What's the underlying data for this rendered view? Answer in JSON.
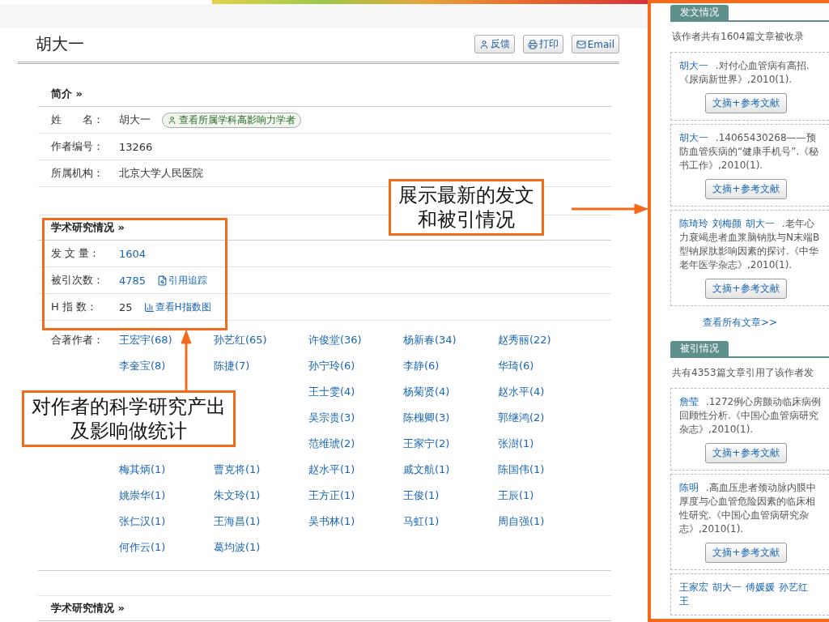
{
  "author_name": "胡大一",
  "actions": [
    {
      "label": "反馈",
      "kind": "feedback"
    },
    {
      "label": "打印",
      "kind": "print"
    },
    {
      "label": "Email",
      "kind": "email"
    }
  ],
  "profile": {
    "title": "简介 »",
    "rows": [
      {
        "label": "姓　　名：",
        "value": "胡大一",
        "badge": "查看所属学科高影响力学者"
      },
      {
        "label": "作者编号：",
        "value": "13266"
      },
      {
        "label": "所属机构：",
        "value": "北京大学人民医院"
      }
    ]
  },
  "research": {
    "title": "学术研究情况 »",
    "rows": [
      {
        "label": "发 文 量：",
        "value": "1604",
        "linked": true
      },
      {
        "label": "被引次数：",
        "value": "4785",
        "linked": true,
        "action": {
          "label": "引用追踪",
          "kind": "trace"
        }
      },
      {
        "label": "H 指 数：",
        "value": "25",
        "linked": false,
        "action": {
          "label": "查看H指数图",
          "kind": "chart"
        }
      }
    ],
    "coauthors_label": "合著作者：",
    "coauthors": [
      {
        "kind": "full",
        "names": [
          "王宏宇(68)",
          "孙艺红(65)",
          "许俊堂(36)",
          "杨新春(34)",
          "赵秀丽(22)"
        ]
      },
      {
        "kind": "full",
        "names": [
          "李奎宝(8)",
          "陈捷(7)",
          "孙宁玲(6)",
          "李静(6)",
          "华琦(6)"
        ]
      },
      {
        "kind": "covered",
        "names": [
          "王士雯(4)",
          "杨菊贤(4)",
          "赵水平(4)"
        ]
      },
      {
        "kind": "covered",
        "names": [
          "吴宗贵(3)",
          "陈槐卿(3)",
          "郭继鸿(2)"
        ]
      },
      {
        "kind": "covered",
        "names": [
          "范维琥(2)",
          "王家宁(2)",
          "张澍(1)"
        ]
      },
      {
        "kind": "full",
        "names": [
          "梅其炳(1)",
          "曹克将(1)",
          "赵水平(1)",
          "戚文航(1)",
          "陈国伟(1)"
        ]
      },
      {
        "kind": "full",
        "names": [
          "姚崇华(1)",
          "朱文玲(1)",
          "王方正(1)",
          "王俊(1)",
          "王辰(1)"
        ]
      },
      {
        "kind": "full",
        "names": [
          "张仁汉(1)",
          "王海昌(1)",
          "吴书林(1)",
          "马虹(1)",
          "周自强(1)"
        ]
      },
      {
        "kind": "full",
        "names": [
          "何作云(1)",
          "葛均波(1)"
        ]
      }
    ]
  },
  "section2": {
    "title": "学术研究情况 »"
  },
  "sidebar": {
    "sections": [
      {
        "tab": "发文情况",
        "summary": "该作者共有1604篇文章被收录",
        "items": [
          {
            "authors": [
              "胡大一"
            ],
            "text": " .对付心血管病有高招.《尿病新世界》,2010(1).",
            "button": "文摘+参考文献"
          },
          {
            "authors": [
              "胡大一"
            ],
            "text": " .14065430268——预防血管疾病的“健康手机号”.《秘书工作》,2010(1).",
            "button": "文摘+参考文献"
          },
          {
            "authors": [
              "陈琦玲",
              "刘梅颜",
              "胡大一"
            ],
            "text": " .老年心力衰竭患者血浆脑钠肽与N末端B型钠尿肽影响因素的探讨.《中华老年医学杂志》,2010(1).",
            "button": "文摘+参考文献"
          }
        ],
        "more": "查看所有文章>>"
      },
      {
        "tab": "被引情况",
        "summary": "共有4353篇文章引用了该作者发",
        "items": [
          {
            "authors": [
              "詹莹"
            ],
            "text": " .1272例心房颤动临床病例回顾性分析.《中国心血管病研究杂志》,2010(1).",
            "button": "文摘+参考文献"
          },
          {
            "authors": [
              "陈明"
            ],
            "text": " .高血压患者颈动脉内膜中厚度与心血管危险因素的临床相性研究.《中国心血管病研究杂志》,2010(1).",
            "button": "文摘+参考文献"
          },
          {
            "authors": [
              "王家宏",
              "胡大一",
              "傅媛媛",
              "孙艺红",
              "王"
            ]
          }
        ]
      }
    ]
  },
  "callouts": [
    {
      "text": "展示最新的发文和被引情况",
      "kind": "right"
    },
    {
      "text": "对作者的科学研究产出及影响做统计",
      "kind": "up"
    }
  ]
}
